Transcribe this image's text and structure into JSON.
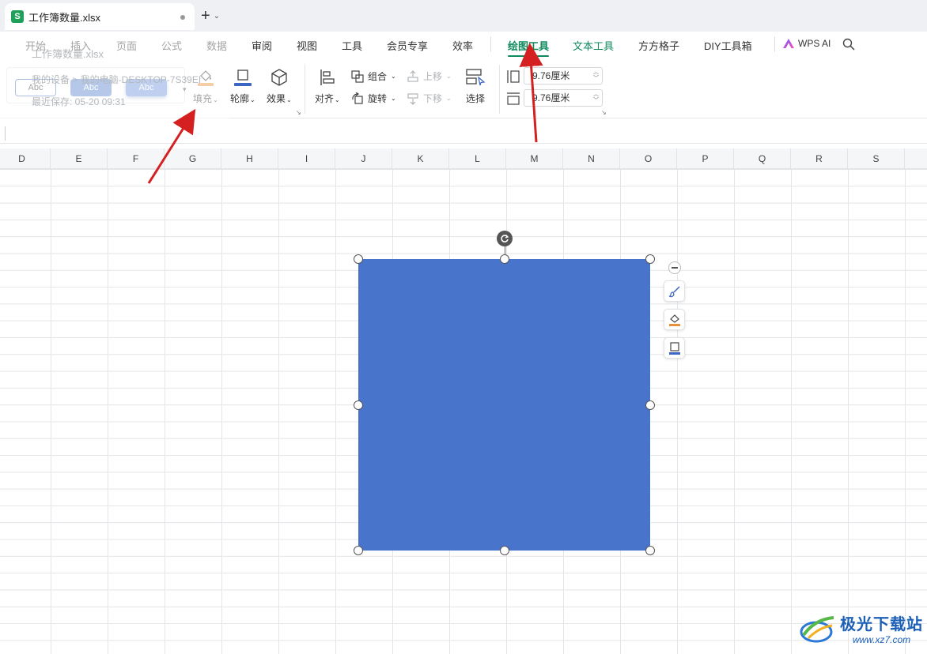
{
  "window": {
    "tab_title": "工作簿数量.xlsx",
    "app_icon_letter": "S"
  },
  "menu": {
    "items": [
      "开始",
      "插入",
      "页面",
      "公式",
      "数据",
      "审阅",
      "视图",
      "工具",
      "会员专享",
      "效率",
      "绘图工具",
      "文本工具",
      "方方格子",
      "DIY工具箱"
    ],
    "active": "绘图工具",
    "ai_label": "WPS AI"
  },
  "ghost_overlay": {
    "doc_title": "工作簿数量.xlsx",
    "location": "我的设备 > 我的电脑-DESKTOP-7S39EI",
    "saved": "最近保存: 05-20 09:31"
  },
  "ribbon": {
    "style_presets": [
      "Abc",
      "Abc",
      "Abc"
    ],
    "fill_label": "填充",
    "outline_label": "轮廓",
    "effect_label": "效果",
    "align_label": "对齐",
    "group_label": "组合",
    "rotate_label": "旋转",
    "move_up_label": "上移",
    "move_down_label": "下移",
    "select_label": "选择",
    "height_value": "9.76厘米",
    "width_value": "9.76厘米"
  },
  "sheet": {
    "columns": [
      "D",
      "E",
      "F",
      "G",
      "H",
      "I",
      "J",
      "K",
      "L",
      "M",
      "N",
      "O",
      "P",
      "Q",
      "R",
      "S"
    ]
  },
  "shape": {
    "fill_color": "#4874cb",
    "kind": "rectangle"
  },
  "colors": {
    "accent_green": "#0e8a5d",
    "annotation_arrow": "#d42020"
  },
  "watermark": {
    "title": "极光下载站",
    "url": "www.xz7.com"
  }
}
